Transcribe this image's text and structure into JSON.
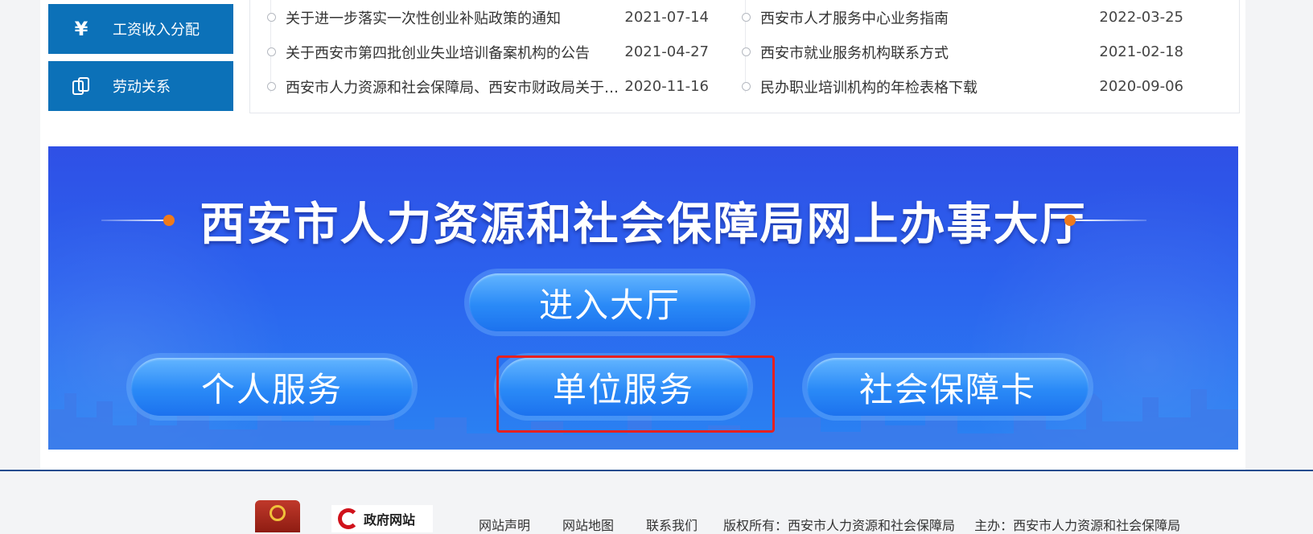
{
  "sidebar": {
    "items": [
      {
        "icon": "yen-icon",
        "label": "工资收入分配",
        "glyph": "¥"
      },
      {
        "icon": "labor-relations-icon",
        "label": "劳动关系"
      }
    ]
  },
  "news": {
    "left": [
      {
        "title": "关于进一步落实一次性创业补贴政策的通知",
        "date": "2021-07-14"
      },
      {
        "title": "关于西安市第四批创业失业培训备案机构的公告",
        "date": "2021-04-27"
      },
      {
        "title": "西安市人力资源和社会保障局、西安市财政局关于落实阶段性减免企业社会保险费政策的通知",
        "date": "2020-11-16"
      }
    ],
    "right": [
      {
        "title": "西安市人才服务中心业务指南",
        "date": "2022-03-25"
      },
      {
        "title": "西安市就业服务机构联系方式",
        "date": "2021-02-18"
      },
      {
        "title": "民办职业培训机构的年检表格下载",
        "date": "2020-09-06"
      }
    ]
  },
  "banner": {
    "title": "西安市人力资源和社会保障局网上办事大厅",
    "enter_label": "进入大厅",
    "personal_label": "个人服务",
    "unit_label": "单位服务",
    "card_label": "社会保障卡"
  },
  "footer": {
    "gov_badge": "政府网站",
    "links": [
      "网站声明",
      "网站地图",
      "联系我们"
    ],
    "copyright": "版权所有：西安市人力资源和社会保障局",
    "sponsor": "主办：西安市人力资源和社会保障局"
  },
  "colors": {
    "side_button": "#0c71b8",
    "banner_top": "#2f50e6",
    "banner_bottom": "#2a83f2",
    "highlight": "#e6201f",
    "accent_dot": "#f07a1a",
    "footer_rule": "#1f4c8f"
  }
}
